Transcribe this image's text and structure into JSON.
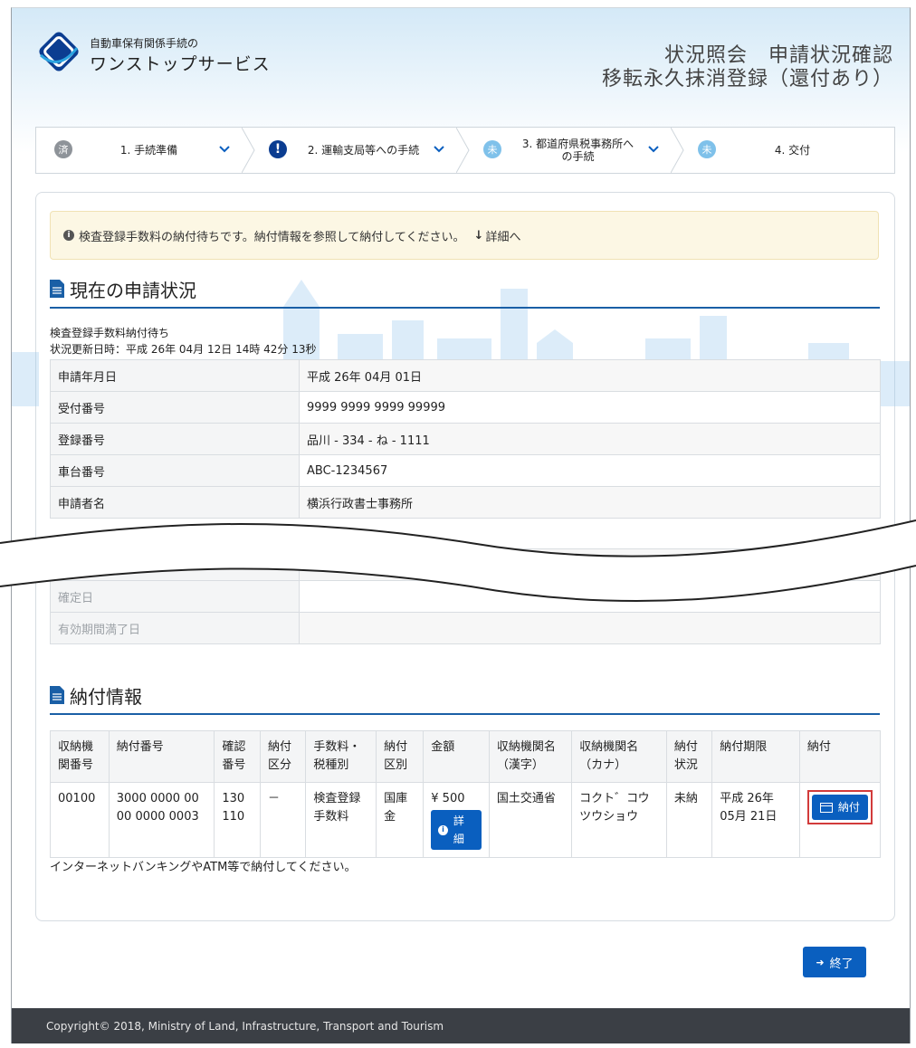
{
  "header": {
    "logo_small": "自動車保有関係手続の",
    "logo_main": "ワンストップサービス",
    "title_line1": "状況照会　申請状況確認",
    "title_line2": "移転永久抹消登録（還付あり）"
  },
  "steps": [
    {
      "icon": "済",
      "label": "1. 手続準備"
    },
    {
      "icon": "!",
      "label": "2. 運輸支局等への手続"
    },
    {
      "icon": "未",
      "label": "3. 都道府県税事務所への手続"
    },
    {
      "icon": "未",
      "label": "4. 交付"
    }
  ],
  "alert": {
    "message": "検査登録手数料の納付待ちです。納付情報を参照して納付してください。",
    "link": "詳細へ"
  },
  "status_section": {
    "title": "現在の申請状況",
    "status": "検査登録手数料納付待ち",
    "updated": "状況更新日時：平成 26年 04月 12日 14時 42分 13秒",
    "rows": [
      {
        "key": "申請年月日",
        "value": "平成 26年 04月 01日"
      },
      {
        "key": "受付番号",
        "value": "9999 9999 9999 99999"
      },
      {
        "key": "登録番号",
        "value": "品川 - 334 - ね - 1111"
      },
      {
        "key": "車台番号",
        "value": "ABC-1234567"
      },
      {
        "key": "申請者名",
        "value": "横浜行政書士事務所"
      }
    ],
    "rows_after": [
      {
        "key": "確定日",
        "value": ""
      },
      {
        "key": "有効期間満了日",
        "value": ""
      }
    ]
  },
  "payment_section": {
    "title": "納付情報",
    "headers": [
      "収納機関番号",
      "納付番号",
      "確認番号",
      "納付区分",
      "手数料・税種別",
      "納付区別",
      "金額",
      "収納機関名（漢字）",
      "収納機関名（カナ）",
      "納付状況",
      "納付期限",
      "納付"
    ],
    "row": {
      "org_no": "00100",
      "pay_no": "3000 0000 00 00 0000 0003",
      "confirm_no": "130 110",
      "division": "－",
      "fee_type": "検査登録手数料",
      "category": "国庫金",
      "amount": "¥ 500",
      "detail_btn": "詳細",
      "org_kanji": "国土交通省",
      "org_kana": "コクト゛コウツウショウ",
      "status": "未納",
      "deadline": "平成 26年 05月 21日",
      "pay_btn": "納付"
    },
    "note": "インターネットバンキングやATM等で納付してください。"
  },
  "exit_button": "終了",
  "footer": "Copyright© 2018, Ministry of Land, Infrastructure, Transport and Tourism"
}
